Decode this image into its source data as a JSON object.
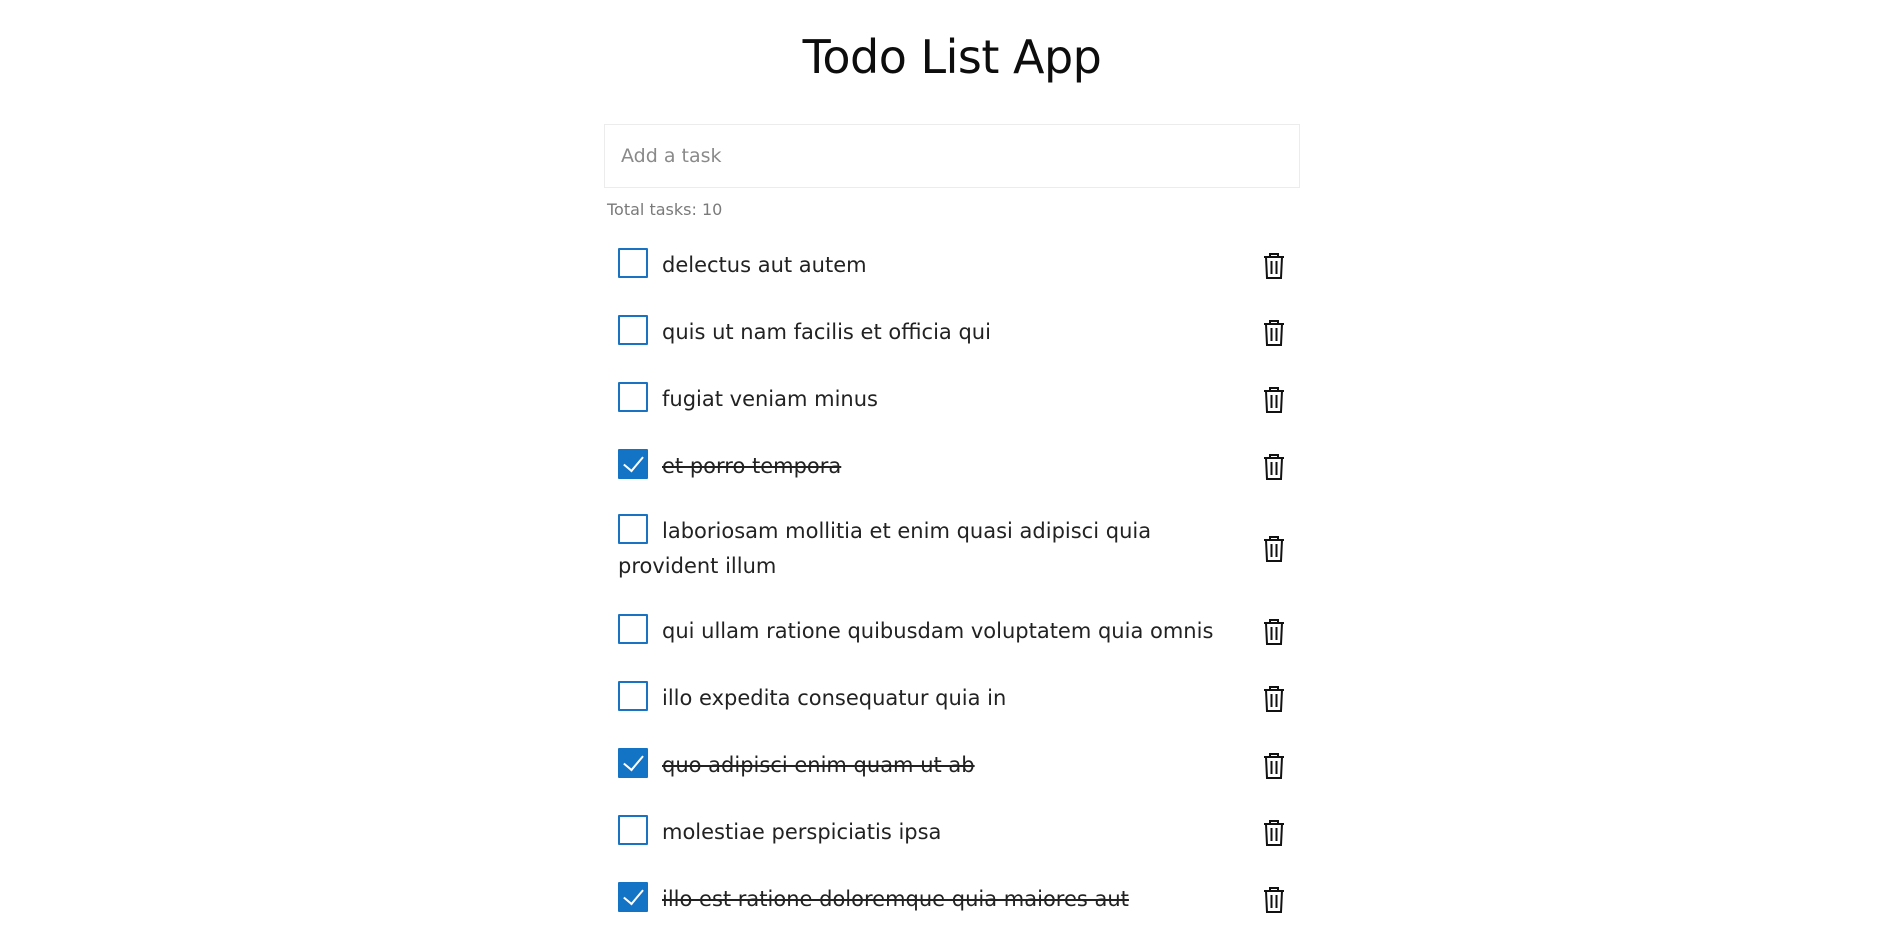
{
  "app": {
    "title": "Todo List App"
  },
  "input": {
    "placeholder": "Add a task"
  },
  "summary": {
    "total_label": "Total tasks: 10"
  },
  "tasks": [
    {
      "text": "delectus aut autem",
      "completed": false
    },
    {
      "text": "quis ut nam facilis et officia qui",
      "completed": false
    },
    {
      "text": "fugiat veniam minus",
      "completed": false
    },
    {
      "text": "et porro tempora",
      "completed": true
    },
    {
      "text": "laboriosam mollitia et enim quasi adipisci quia provident illum",
      "completed": false
    },
    {
      "text": "qui ullam ratione quibusdam voluptatem quia omnis",
      "completed": false
    },
    {
      "text": "illo expedita consequatur quia in",
      "completed": false
    },
    {
      "text": "quo adipisci enim quam ut ab",
      "completed": true
    },
    {
      "text": "molestiae perspiciatis ipsa",
      "completed": false
    },
    {
      "text": "illo est ratione doloremque quia maiores aut",
      "completed": true
    }
  ],
  "icons": {
    "delete": "trash-icon",
    "check": "checkmark-icon"
  },
  "colors": {
    "accent": "#1373c5",
    "text": "#222222",
    "muted": "#7a7a7a"
  }
}
